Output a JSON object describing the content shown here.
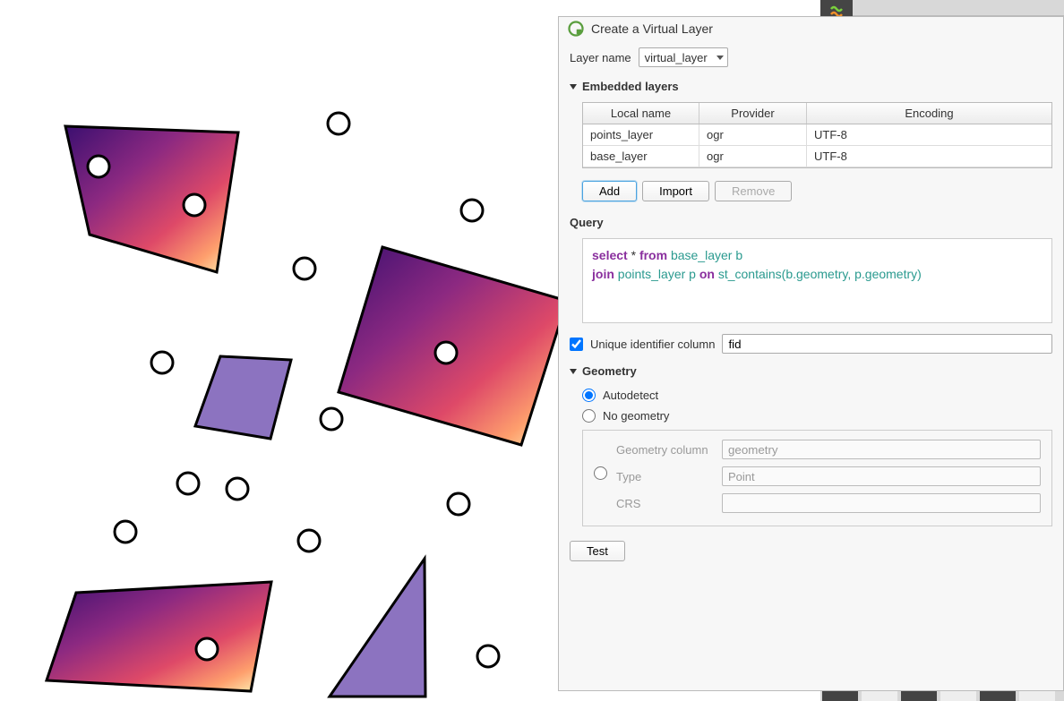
{
  "dialog": {
    "title": "Create a Virtual Layer",
    "layer_name_label": "Layer name",
    "layer_name_value": "virtual_layer",
    "embedded_layers_label": "Embedded layers",
    "table": {
      "headers": {
        "local": "Local name",
        "provider": "Provider",
        "encoding": "Encoding"
      },
      "rows": [
        {
          "local": "points_layer",
          "provider": "ogr",
          "encoding": "UTF-8"
        },
        {
          "local": "base_layer",
          "provider": "ogr",
          "encoding": "UTF-8"
        }
      ]
    },
    "buttons": {
      "add": "Add",
      "import": "Import",
      "remove": "Remove",
      "test": "Test"
    },
    "query_label": "Query",
    "query": {
      "kw_select": "select",
      "star": "*",
      "kw_from": "from",
      "tbl1": "base_layer b",
      "kw_join": "join",
      "tbl2": "points_layer p",
      "kw_on": "on",
      "fn": "st_contains",
      "args": "(b.geometry, p.geometry)"
    },
    "uid_label": "Unique identifier column",
    "uid_value": "fid",
    "geometry_label": "Geometry",
    "geom_autodetect": "Autodetect",
    "geom_none": "No geometry",
    "geom_col_label": "Geometry column",
    "geom_col_value": "geometry",
    "geom_type_label": "Type",
    "geom_type_value": "Point",
    "geom_crs_label": "CRS"
  }
}
